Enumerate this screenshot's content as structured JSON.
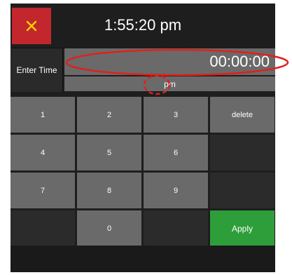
{
  "header": {
    "close_label": "×",
    "clock": "1:55:20 pm"
  },
  "entry": {
    "label": "Enter Time",
    "value": "00:00:00",
    "ampm": "pm"
  },
  "keypad": {
    "k1": "1",
    "k2": "2",
    "k3": "3",
    "delete": "delete",
    "k4": "4",
    "k5": "5",
    "k6": "6",
    "k7": "7",
    "k8": "8",
    "k9": "9",
    "k0": "0",
    "apply": "Apply"
  },
  "colors": {
    "close": "#c1272d",
    "apply": "#2e9e3a",
    "annotation": "#e0201b"
  }
}
